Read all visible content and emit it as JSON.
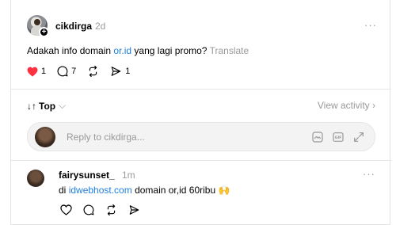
{
  "post": {
    "username": "cikdirga",
    "time": "2d",
    "more": "···",
    "text_before": "Adakah info domain ",
    "text_link": "or.id",
    "text_after": " yang lagi promo?",
    "translate": "Translate",
    "likes": "1",
    "comments": "7",
    "shares": "1",
    "like_color": "#ff3040"
  },
  "sort": {
    "label": "Top",
    "arrows": "↓↑",
    "chevron": "⌵",
    "view_activity": "View activity ›"
  },
  "reply": {
    "placeholder": "Reply to cikdirga..."
  },
  "comment": {
    "username": "fairysunset_",
    "time": "1m",
    "more": "···",
    "text_before": "di ",
    "text_link": "idwebhost.com",
    "text_after": " domain or,id 60ribu 🙌"
  },
  "colors": {
    "link": "#1f7fe0",
    "muted": "#999999"
  }
}
